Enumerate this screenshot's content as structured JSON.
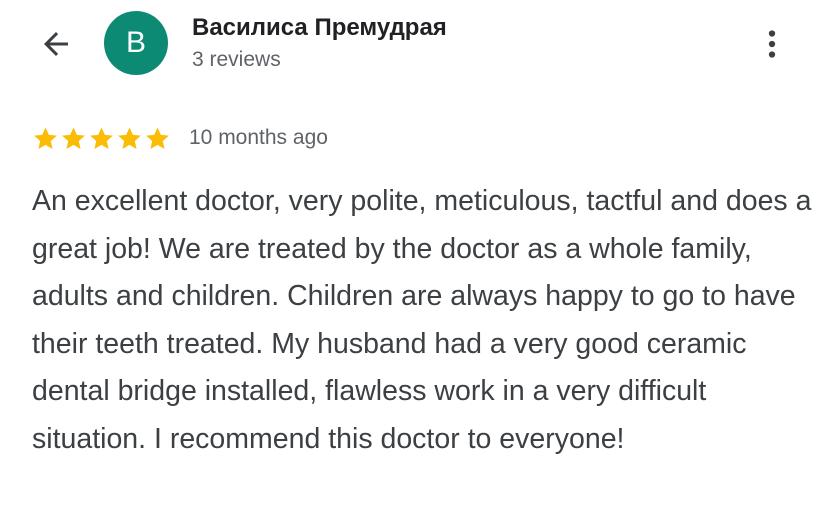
{
  "header": {
    "back_icon": "arrow-back-icon",
    "avatar_letter": "B",
    "avatar_color": "#0d8a74",
    "reviewer_name": "Василиса Премудрая",
    "review_count": "3 reviews",
    "more_icon": "more-vertical-icon"
  },
  "review": {
    "rating": 5,
    "max_rating": 5,
    "star_color": "#fbbc04",
    "date": "10 months ago",
    "text": "An excellent doctor, very polite, meticulous, tactful and does a great job! We are treated by the doctor as a whole family, adults and children. Children are always happy to go to have their teeth treated. My husband had a very good ceramic dental bridge installed, flawless work in a very difficult situation. I recommend this doctor to everyone!"
  }
}
